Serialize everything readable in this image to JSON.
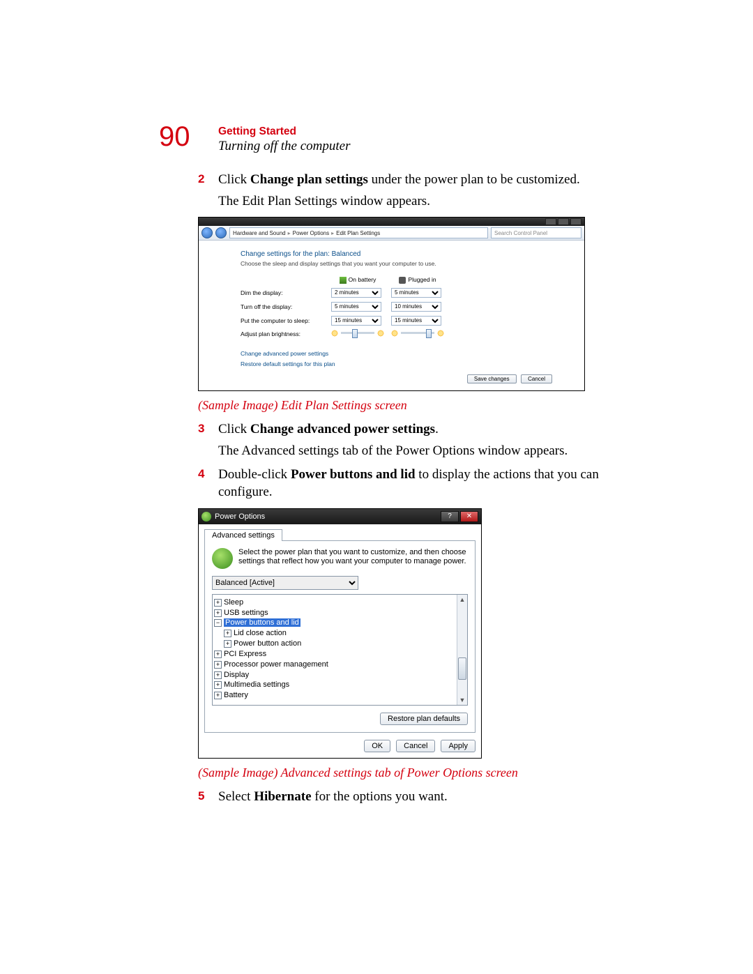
{
  "page_number": "90",
  "chapter": "Getting Started",
  "section": "Turning off the computer",
  "steps": {
    "s2": {
      "num": "2",
      "a": "Click ",
      "b": "Change plan settings",
      "c": " under the power plan to be customized.",
      "follow": "The Edit Plan Settings window appears."
    },
    "s3": {
      "num": "3",
      "a": "Click ",
      "b": "Change advanced power settings",
      "c": ".",
      "follow": "The Advanced settings tab of the Power Options window appears."
    },
    "s4": {
      "num": "4",
      "a": "Double-click ",
      "b": "Power buttons and lid",
      "c": " to display the actions that you can configure."
    },
    "s5": {
      "num": "5",
      "a": "Select ",
      "b": "Hibernate",
      "c": " for the options you want."
    }
  },
  "captions": {
    "c1": "(Sample Image) Edit Plan Settings screen",
    "c2": "(Sample Image) Advanced settings tab of Power Options screen"
  },
  "shot1": {
    "crumb1": "Hardware and Sound",
    "crumb2": "Power Options",
    "crumb3": "Edit Plan Settings",
    "search_placeholder": "Search Control Panel",
    "heading": "Change settings for the plan: Balanced",
    "subtext": "Choose the sleep and display settings that you want your computer to use.",
    "col_battery": "On battery",
    "col_plugged": "Plugged in",
    "rows": {
      "dim": "Dim the display:",
      "off": "Turn off the display:",
      "sleep": "Put the computer to sleep:",
      "bright": "Adjust plan brightness:"
    },
    "vals": {
      "dim_b": "2 minutes",
      "dim_p": "5 minutes",
      "off_b": "5 minutes",
      "off_p": "10 minutes",
      "sleep_b": "15 minutes",
      "sleep_p": "15 minutes"
    },
    "link_adv": "Change advanced power settings",
    "link_restore": "Restore default settings for this plan",
    "btn_save": "Save changes",
    "btn_cancel": "Cancel"
  },
  "shot2": {
    "title": "Power Options",
    "tab": "Advanced settings",
    "intro": "Select the power plan that you want to customize, and then choose settings that reflect how you want your computer to manage power.",
    "plan": "Balanced [Active]",
    "tree": {
      "sleep": "Sleep",
      "usb": "USB settings",
      "pbl": "Power buttons and lid",
      "lid": "Lid close action",
      "pba": "Power button action",
      "pci": "PCI Express",
      "ppm": "Processor power management",
      "display": "Display",
      "mm": "Multimedia settings",
      "batt": "Battery"
    },
    "btn_restore": "Restore plan defaults",
    "btn_ok": "OK",
    "btn_cancel": "Cancel",
    "btn_apply": "Apply"
  }
}
